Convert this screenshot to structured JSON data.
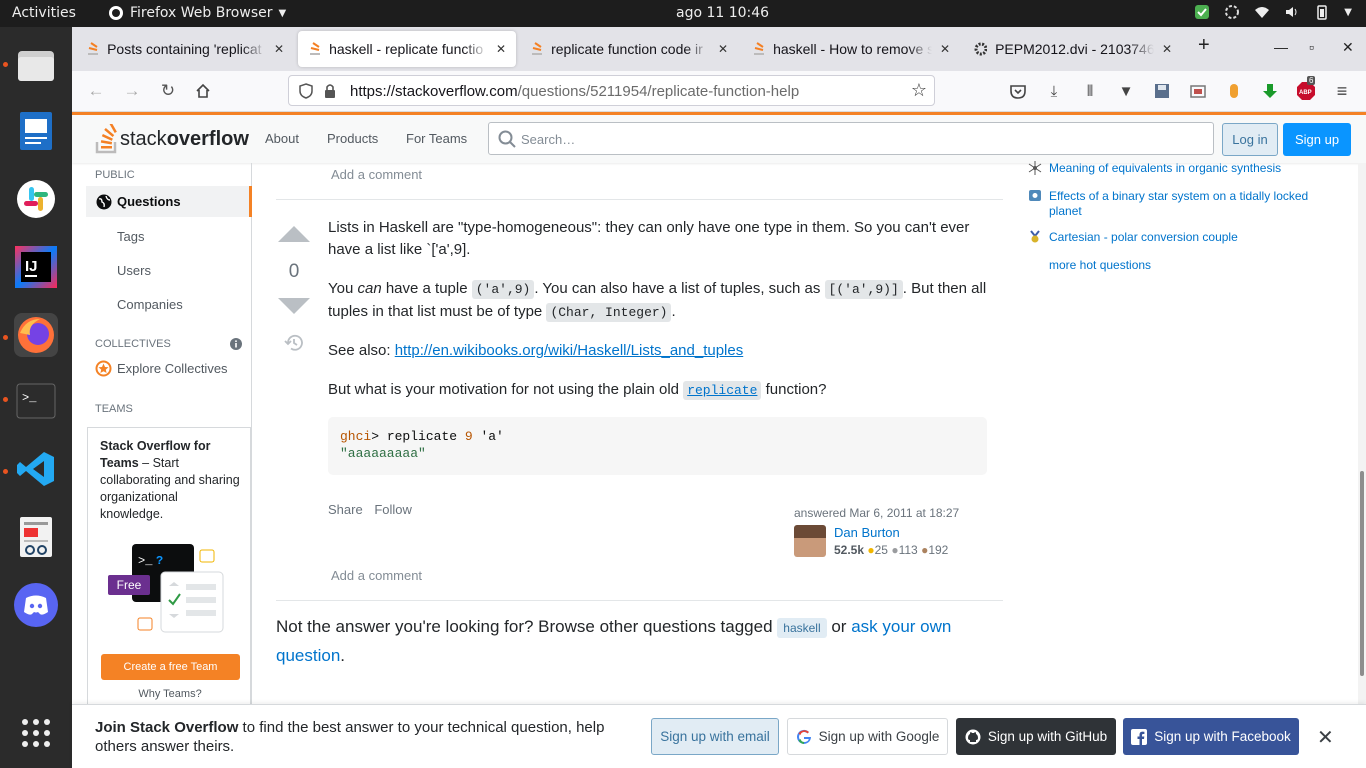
{
  "topbar": {
    "activities": "Activities",
    "app_menu": "Firefox Web Browser",
    "clock": "ago 11  10:46"
  },
  "tabs": [
    {
      "label": "Posts containing 'replicat"
    },
    {
      "label": "haskell - replicate functio"
    },
    {
      "label": "replicate function code ir"
    },
    {
      "label": "haskell - How to remove s"
    },
    {
      "label": "PEPM2012.dvi - 2103746"
    }
  ],
  "toolbar": {
    "url_host": "https://stackoverflow.com",
    "url_path": "/questions/5211954/replicate-function-help",
    "abp_badge": "6"
  },
  "so_header": {
    "logo_light": "stack",
    "logo_bold": "overflow",
    "nav": [
      "About",
      "Products",
      "For Teams"
    ],
    "search_placeholder": "Search…",
    "login": "Log in",
    "signup": "Sign up"
  },
  "leftnav": {
    "public_head": "PUBLIC",
    "questions": "Questions",
    "tags": "Tags",
    "users": "Users",
    "companies": "Companies",
    "collectives_head": "COLLECTIVES",
    "explore_collectives": "Explore Collectives",
    "teams_head": "TEAMS",
    "teams_title": "Stack Overflow for Teams",
    "teams_desc": " – Start collaborating and sharing organizational knowledge.",
    "free_badge": "Free",
    "create_team": "Create a free Team",
    "why_teams": "Why Teams?"
  },
  "answer": {
    "add_comment": "Add a comment",
    "vote_count": "0",
    "p1": "Lists in Haskell are \"type-homogeneous\": they can only have one type in them. So you can't ever have a list like `['a',9].",
    "p2_a": "You ",
    "p2_em": "can",
    "p2_b": " have a tuple ",
    "p2_code1": "('a',9)",
    "p2_c": ". You can also have a list of tuples, such as ",
    "p2_code2": "[('a',9)]",
    "p2_d": ". But then all tuples in that list must be of type ",
    "p2_code3": "(Char, Integer)",
    "p2_e": ".",
    "p3_a": "See also: ",
    "p3_link": "http://en.wikibooks.org/wiki/Haskell/Lists_and_tuples",
    "p4_a": "But what is your motivation for not using the plain old ",
    "p4_code": "replicate",
    "p4_b": " function?",
    "code_prompt": "ghci",
    "code_rest": "> replicate ",
    "code_num": "9",
    "code_arg": " 'a'",
    "code_output": "\"aaaaaaaaa\"",
    "share": "Share",
    "follow": "Follow",
    "answered": "answered Mar 6, 2011 at 18:27",
    "user_name": "Dan Burton",
    "user_rep": "52.5k",
    "gold": "25",
    "silver": "113",
    "bronze": "192",
    "add_comment2": "Add a comment"
  },
  "not_answer": {
    "text": "Not the answer you're looking for? Browse other questions tagged ",
    "tag": "haskell",
    "or": " or ",
    "ask_link": "ask your own question",
    "end": "."
  },
  "hnq": [
    {
      "title": "Meaning of equivalents in organic synthesis"
    },
    {
      "title": "Effects of a binary star system on a tidally locked planet"
    },
    {
      "title": "Cartesian - polar conversion couple"
    },
    {
      "title": "more hot questions"
    }
  ],
  "banner": {
    "bold": "Join Stack Overflow",
    "text": " to find the best answer to your technical question, help others answer theirs.",
    "email": "Sign up with email",
    "google": "Sign up with Google",
    "github": "Sign up with GitHub",
    "facebook": "Sign up with Facebook"
  },
  "colors": {
    "so_orange": "#f48225",
    "so_blue": "#0a95ff",
    "link_blue": "#0074cc",
    "ubuntu_orange": "#e95420"
  }
}
